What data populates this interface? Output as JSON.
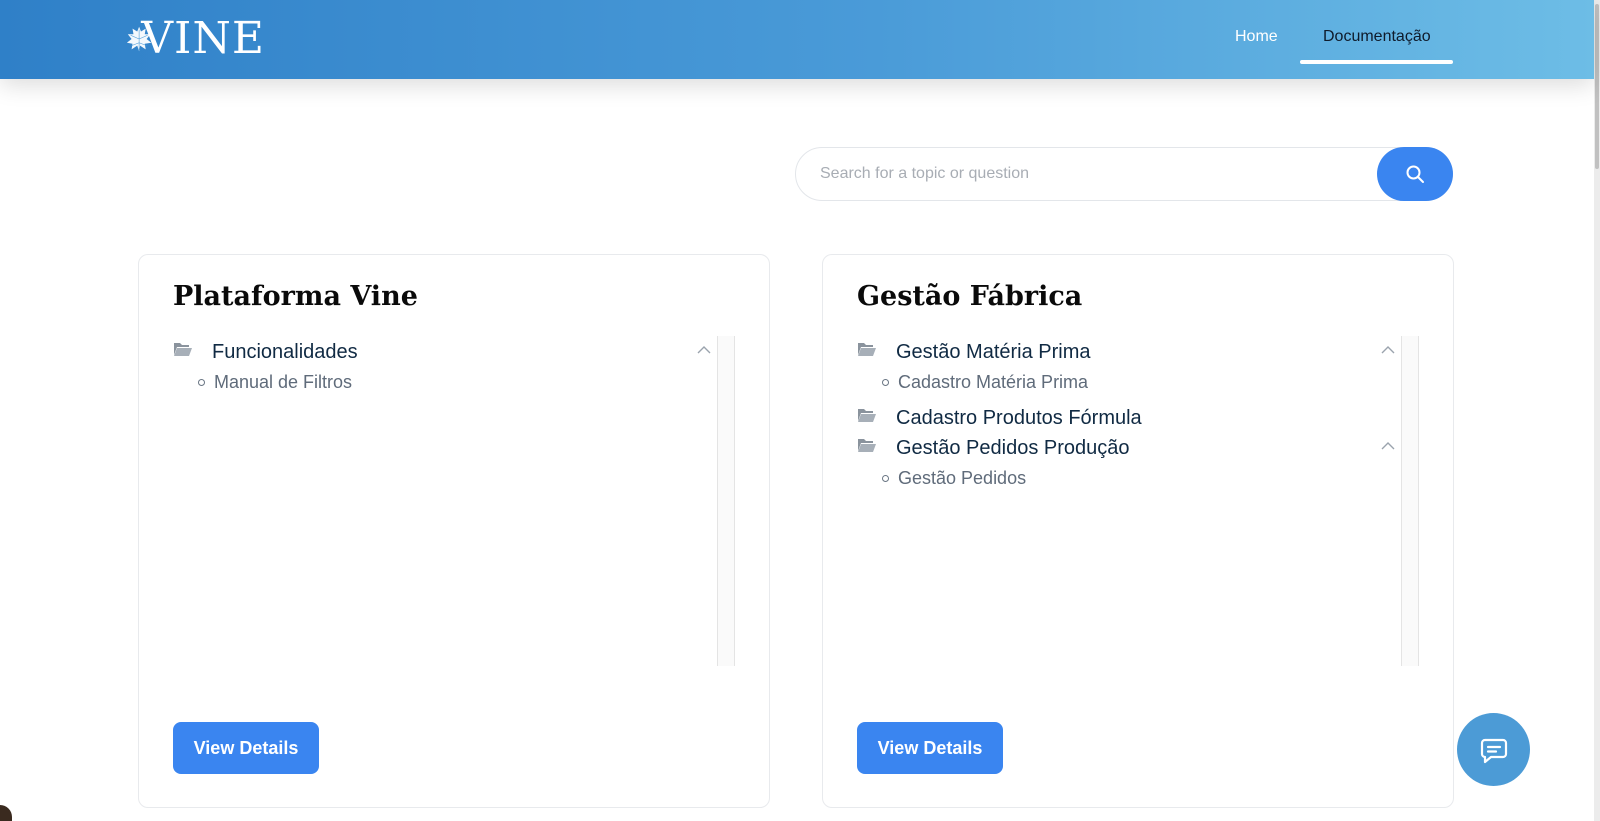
{
  "header": {
    "logo_text": "VINE",
    "nav": [
      {
        "label": "Home",
        "active": false
      },
      {
        "label": "Documentação",
        "active": true
      }
    ]
  },
  "search": {
    "placeholder": "Search for a topic or question",
    "value": ""
  },
  "cards": [
    {
      "title": "Plataforma Vine",
      "button_label": "View Details",
      "groups": [
        {
          "label": "Funcionalidades",
          "expanded": true,
          "items": [
            "Manual de Filtros"
          ]
        }
      ]
    },
    {
      "title": "Gestão Fábrica",
      "button_label": "View Details",
      "groups": [
        {
          "label": "Gestão Matéria Prima",
          "expanded": true,
          "items": [
            "Cadastro Matéria Prima"
          ]
        },
        {
          "label": "Cadastro Produtos Fórmula",
          "expanded": false,
          "items": []
        },
        {
          "label": "Gestão Pedidos Produção",
          "expanded": true,
          "items": [
            "Gestão Pedidos"
          ]
        }
      ]
    }
  ],
  "colors": {
    "header_start": "#2f80c8",
    "header_end": "#6dbde6",
    "primary_button": "#3a85f0",
    "chat_fab": "#4c9bd6"
  },
  "icons": {
    "search": "search-icon",
    "folder": "folder-open-icon",
    "chevron": "chevron-up-icon",
    "chat": "chat-icon"
  }
}
